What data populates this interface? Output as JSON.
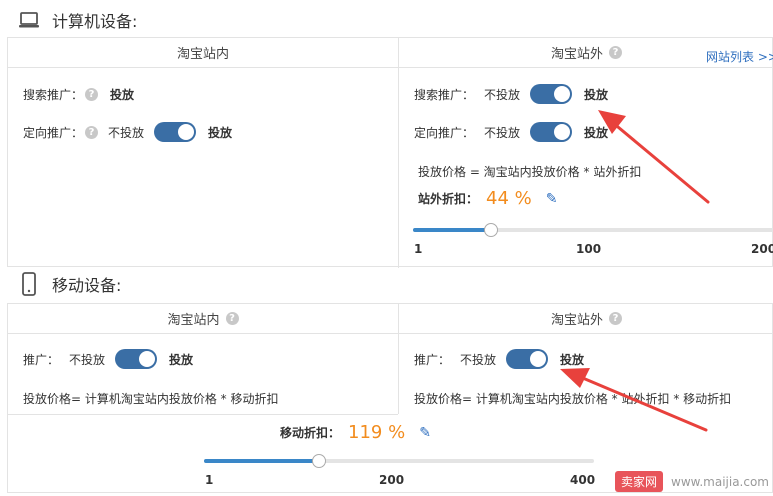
{
  "computer": {
    "title": "计算机设备:",
    "inside": {
      "header": "淘宝站内",
      "search_label": "搜索推广：",
      "search_value": "投放",
      "target_label": "定向推广：",
      "target_off": "不投放",
      "target_on": "投放"
    },
    "outside": {
      "header": "淘宝站外",
      "site_list": "网站列表 >>",
      "search_label": "搜索推广：",
      "search_off": "不投放",
      "search_on": "投放",
      "target_label": "定向推广：",
      "target_off": "不投放",
      "target_on": "投放",
      "formula": "投放价格 = 淘宝站内投放价格 * 站外折扣",
      "discount_label": "站外折扣：",
      "discount_value": "44 %",
      "discount_level_pct": 44,
      "slider_min": "1",
      "slider_mid": "100",
      "slider_max": "200"
    }
  },
  "mobile": {
    "title": "移动设备:",
    "inside": {
      "header": "淘宝站内",
      "promo_label": "推广：",
      "promo_off": "不投放",
      "promo_on": "投放",
      "formula": "投放价格= 计算机淘宝站内投放价格 * 移动折扣"
    },
    "outside": {
      "header": "淘宝站外",
      "promo_label": "推广：",
      "promo_off": "不投放",
      "promo_on": "投放",
      "formula": "投放价格= 计算机淘宝站内投放价格 * 站外折扣 * 移动折扣"
    },
    "discount_label": "移动折扣：",
    "discount_value": "119 %",
    "discount_level_pct": 119,
    "slider_min": "1",
    "slider_mid": "200",
    "slider_max": "400"
  },
  "watermark": {
    "logo": "卖家网",
    "url": "www.maijia.com"
  },
  "colors": {
    "accent": "#3a6ea5",
    "discount": "#f28c1e",
    "link": "#2f6fbf",
    "arrow": "#e8413c"
  }
}
